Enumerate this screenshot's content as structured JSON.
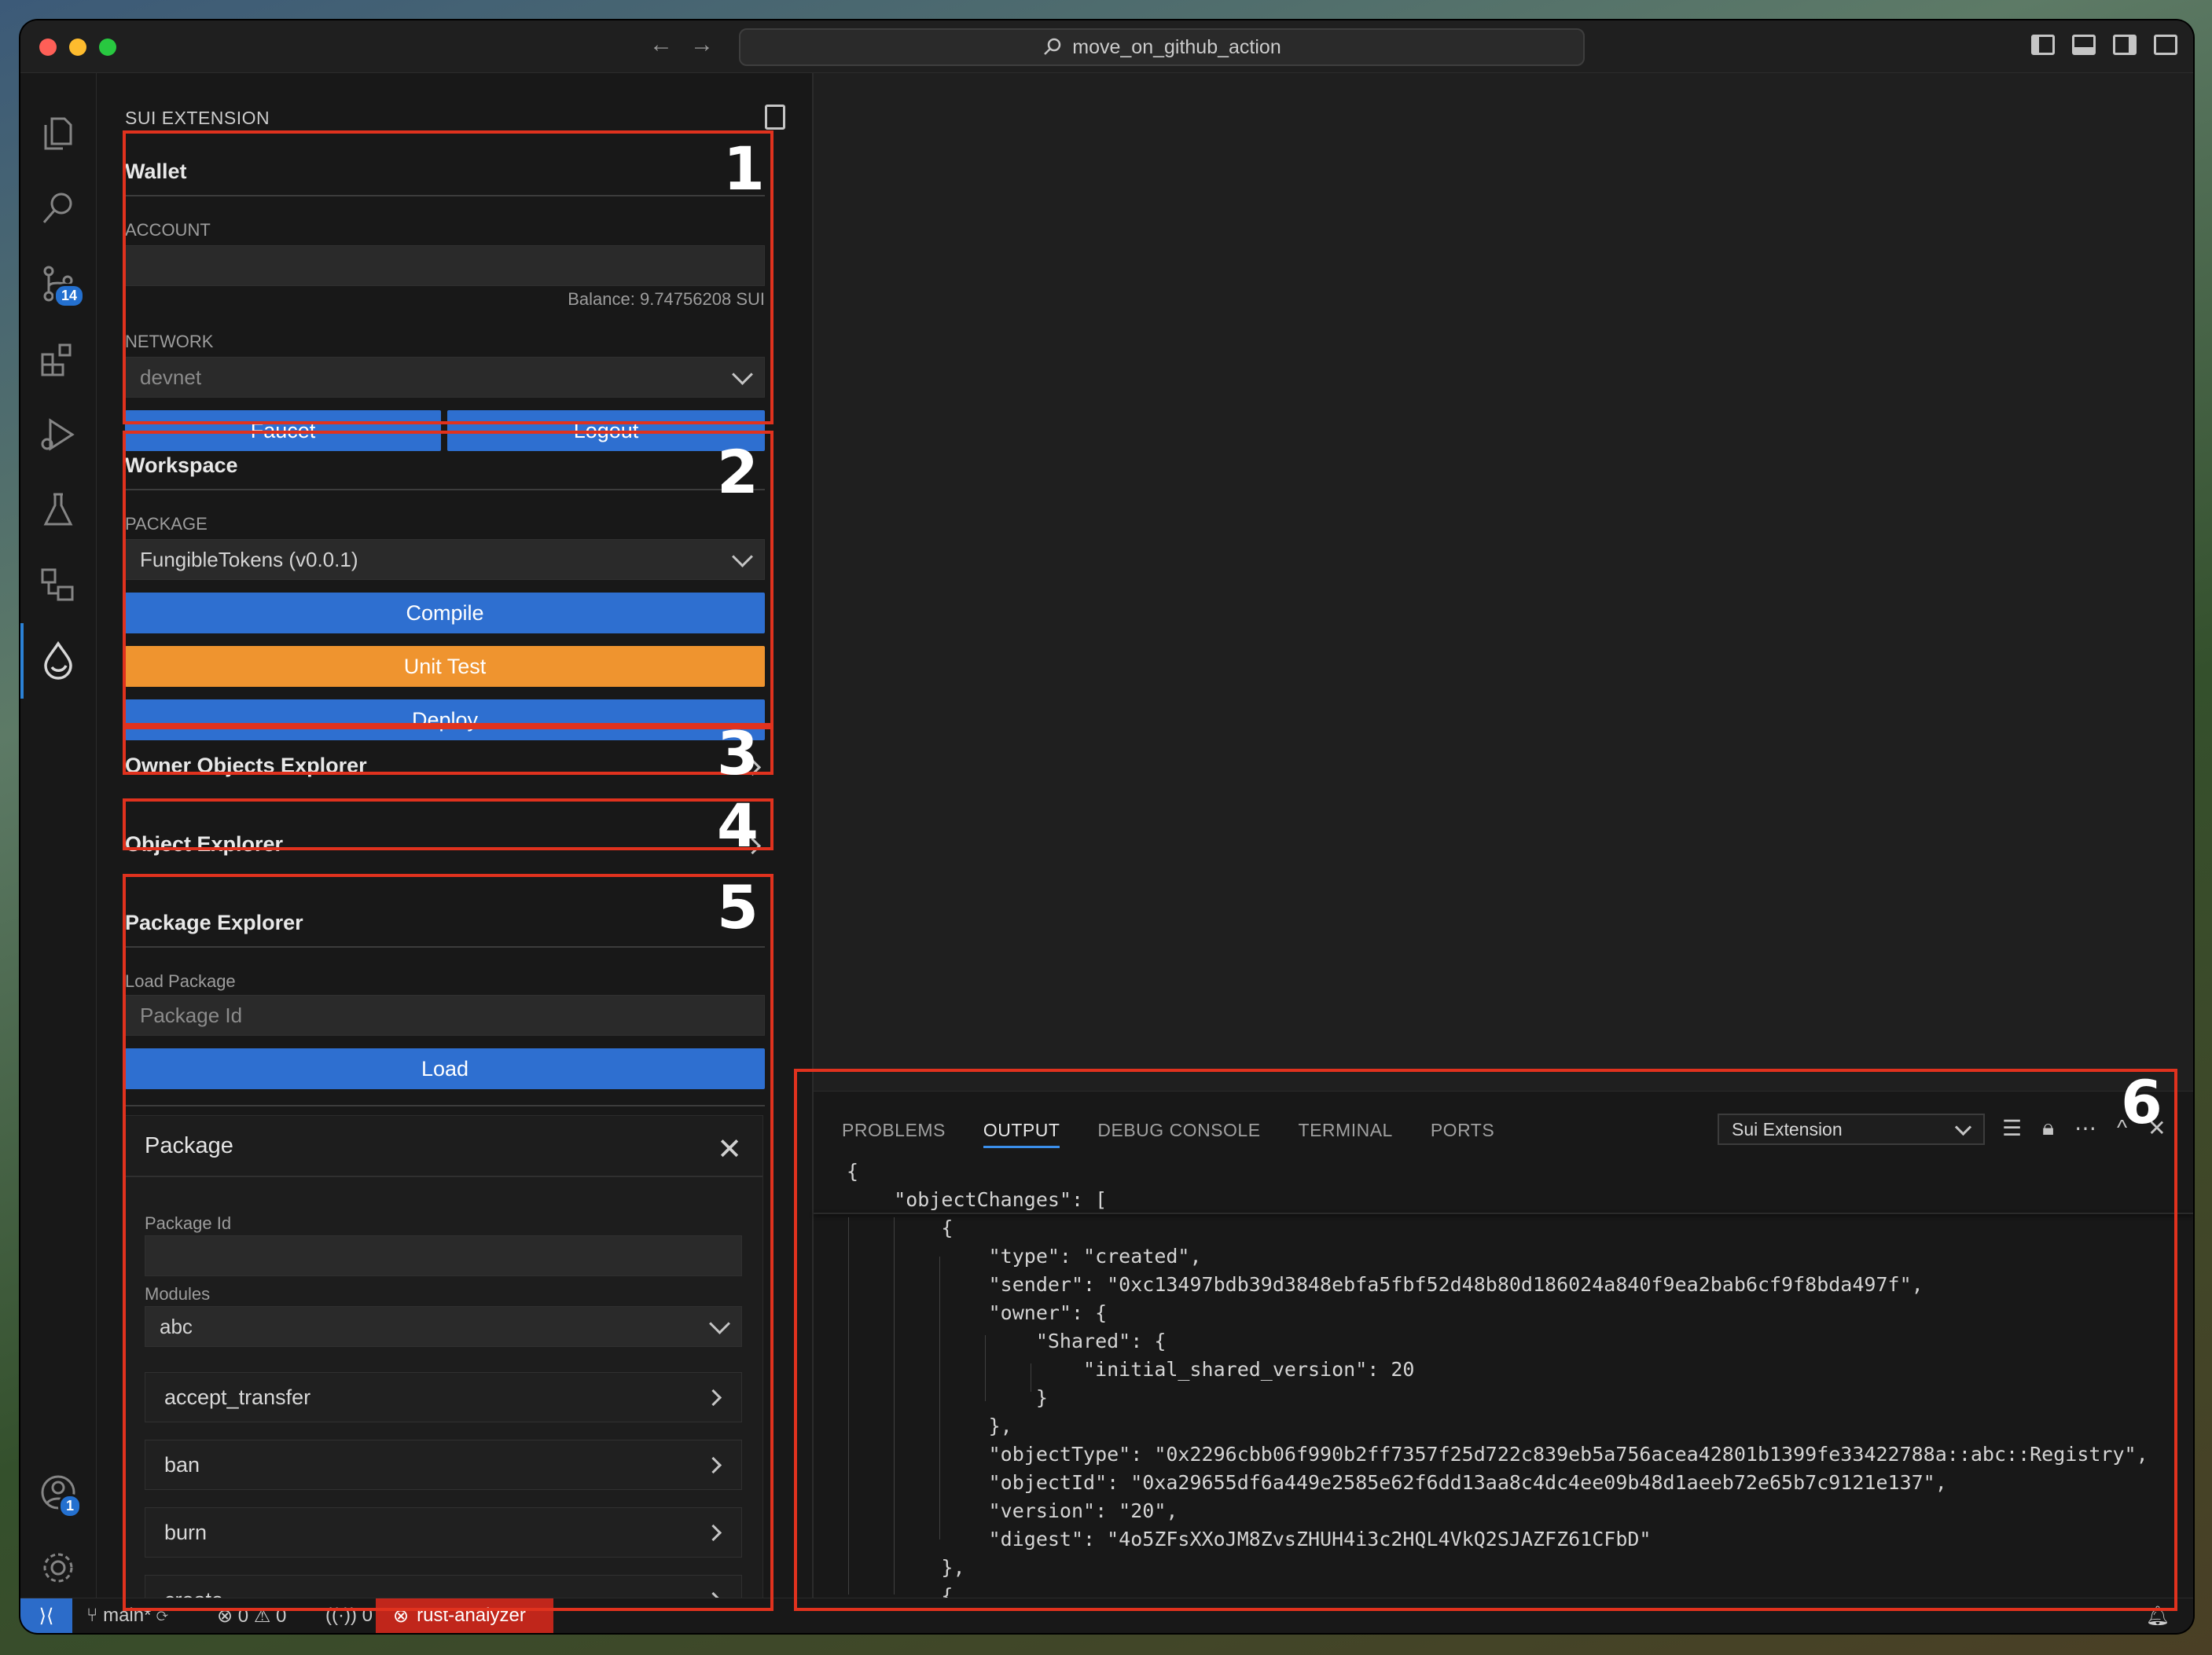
{
  "window": {
    "title": "move_on_github_action"
  },
  "sidebar": {
    "title": "SUI EXTENSION",
    "wallet": {
      "header": "Wallet",
      "account_label": "ACCOUNT",
      "account_value": "",
      "balance": "Balance: 9.74756208 SUI",
      "network_label": "NETWORK",
      "network_value": "devnet",
      "faucet_label": "Faucet",
      "logout_label": "Logout"
    },
    "workspace": {
      "header": "Workspace",
      "package_label": "PACKAGE",
      "package_value": "FungibleTokens (v0.0.1)",
      "compile_label": "Compile",
      "unit_test_label": "Unit Test",
      "deploy_label": "Deploy"
    },
    "owner_objects": {
      "header": "Owner Objects Explorer"
    },
    "object_explorer": {
      "header": "Object Explorer"
    },
    "package_explorer": {
      "header": "Package Explorer",
      "load_label": "Load Package",
      "package_id_placeholder": "Package Id",
      "load_button": "Load",
      "card": {
        "title": "Package",
        "package_id_label": "Package Id",
        "package_id_value": "",
        "modules_label": "Modules",
        "module_value": "abc",
        "functions": [
          "accept_transfer",
          "ban",
          "burn",
          "create"
        ]
      }
    }
  },
  "annotations": [
    "1",
    "2",
    "3",
    "4",
    "5",
    "6"
  ],
  "activity_badges": {
    "source_control": "14",
    "accounts": "1"
  },
  "panel": {
    "tabs": [
      "PROBLEMS",
      "OUTPUT",
      "DEBUG CONSOLE",
      "TERMINAL",
      "PORTS"
    ],
    "active_tab": "OUTPUT",
    "output_channel": "Sui Extension",
    "output_lines": [
      "{",
      "    \"objectChanges\": [",
      "        {",
      "            \"type\": \"created\",",
      "            \"sender\": \"0xc13497bdb39d3848ebfa5fbf52d48b80d186024a840f9ea2bab6cf9f8bda497f\",",
      "            \"owner\": {",
      "                \"Shared\": {",
      "                    \"initial_shared_version\": 20",
      "                }",
      "            },",
      "            \"objectType\": \"0x2296cbb06f990b2ff7357f25d722c839eb5a756acea42801b1399fe33422788a::abc::Registry\",",
      "            \"objectId\": \"0xa29655df6a449e2585e62f6dd13aa8c4dc4ee09b48d1aeeb72e65b7c9121e137\",",
      "            \"version\": \"20\",",
      "            \"digest\": \"4o5ZFsXXoJM8ZvsZHUH4i3c2HQL4VkQ2SJAZFZ61CFbD\"",
      "        },",
      "        {"
    ]
  },
  "statusbar": {
    "branch": "main*",
    "errors": "0",
    "warnings": "0",
    "ports": "0",
    "error_item": "rust-analyzer"
  }
}
